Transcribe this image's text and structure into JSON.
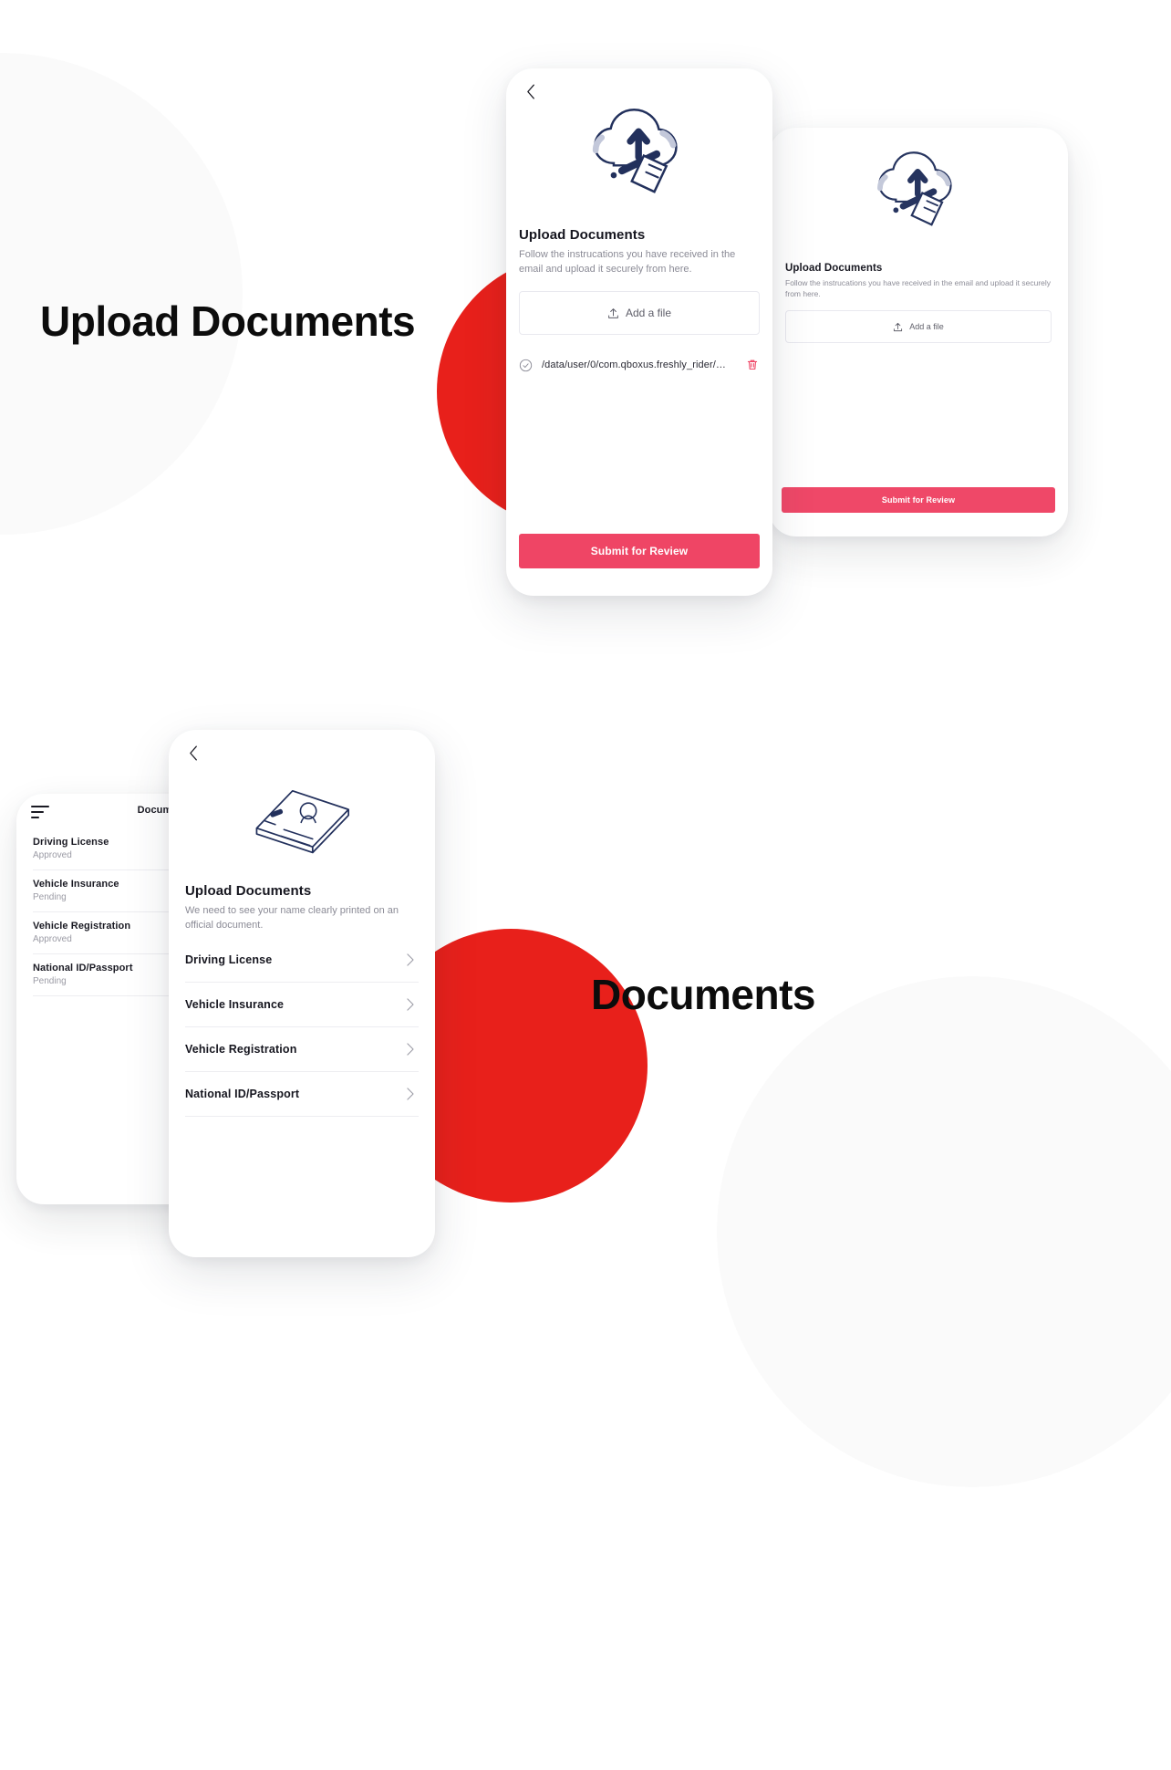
{
  "page": {
    "background": "#ffffff",
    "accent_red": "#e8201b",
    "accent_pink": "#ef4565",
    "ink": "#16161f",
    "muted": "#8b8b96"
  },
  "sections": [
    {
      "heading": "Upload Documents"
    },
    {
      "heading": "Documents"
    }
  ],
  "upload_screen": {
    "back_icon": "chevron-left-icon",
    "illustration": "cloud-upload-document-illustration",
    "title": "Upload Documents",
    "subtitle": "Follow the instrucations you have received in the email and upload it securely from here.",
    "add_file": {
      "label": "Add a file",
      "icon": "upload-icon"
    },
    "uploaded_file": {
      "status_icon": "check-circle-icon",
      "path": "/data/user/0/com.qboxus.freshly_rider/…",
      "delete_icon": "trash-icon"
    },
    "submit": {
      "label": "Submit for Review",
      "color": "#ef4565"
    }
  },
  "documents_picker_screen": {
    "back_icon": "chevron-left-icon",
    "illustration": "id-card-illustration",
    "title": "Upload Documents",
    "subtitle": "We need to see your name clearly printed on an official document.",
    "items": [
      {
        "label": "Driving License",
        "chevron": "chevron-right-icon"
      },
      {
        "label": "Vehicle Insurance",
        "chevron": "chevron-right-icon"
      },
      {
        "label": "Vehicle Registration",
        "chevron": "chevron-right-icon"
      },
      {
        "label": "National ID/Passport",
        "chevron": "chevron-right-icon"
      }
    ]
  },
  "documents_status_screen": {
    "menu_icon": "hamburger-menu-icon",
    "title": "Documents",
    "items": [
      {
        "name": "Driving License",
        "status": "Approved"
      },
      {
        "name": "Vehicle Insurance",
        "status": "Pending"
      },
      {
        "name": "Vehicle Registration",
        "status": "Approved"
      },
      {
        "name": "National ID/Passport",
        "status": "Pending"
      }
    ]
  }
}
